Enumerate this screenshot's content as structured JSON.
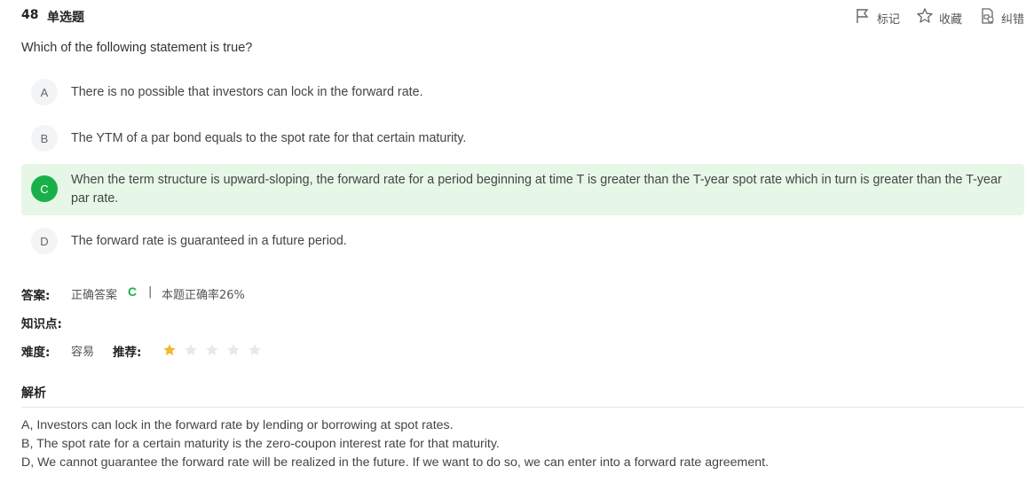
{
  "header": {
    "number": "48",
    "type": "单选题",
    "actions": [
      {
        "label": "标记",
        "icon": "flag-icon"
      },
      {
        "label": "收藏",
        "icon": "star-outline-icon"
      },
      {
        "label": "纠错",
        "icon": "report-error-icon"
      }
    ]
  },
  "question": "Which of the following statement is true?",
  "options": [
    {
      "letter": "A",
      "text": "There is no possible that investors can lock in the forward rate.",
      "correct": false
    },
    {
      "letter": "B",
      "text": "The YTM of a par bond equals to the spot rate for that certain maturity.",
      "correct": false
    },
    {
      "letter": "C",
      "text": "When the term structure is upward-sloping, the forward rate for a period beginning at time T is greater than the T-year spot rate which in turn is greater than the T-year par rate.",
      "correct": true
    },
    {
      "letter": "D",
      "text": "The forward rate is guaranteed in a future period.",
      "correct": false
    }
  ],
  "answer": {
    "label": "答案:",
    "correct_prefix": "正确答案",
    "correct_letter": "C",
    "separator": "|",
    "accuracy_text": "本题正确率26%"
  },
  "knowledge": {
    "label": "知识点:"
  },
  "difficulty": {
    "label": "难度:",
    "value": "容易"
  },
  "recommend": {
    "label": "推荐:",
    "rating": 1,
    "max": 5
  },
  "colors": {
    "accent": "#19b04a",
    "correct_bg": "#e6f7e7",
    "star_on": "#f5b82e",
    "star_off": "#e8e8e8"
  },
  "analysis": {
    "title": "解析",
    "lines": [
      "A, Investors can lock in the forward rate by lending or borrowing at spot rates.",
      "B, The spot rate for a certain maturity is the zero-coupon interest rate for that maturity.",
      "D, We cannot guarantee the forward rate will be realized in the future. If we want to do so, we can enter into a forward rate agreement."
    ]
  }
}
